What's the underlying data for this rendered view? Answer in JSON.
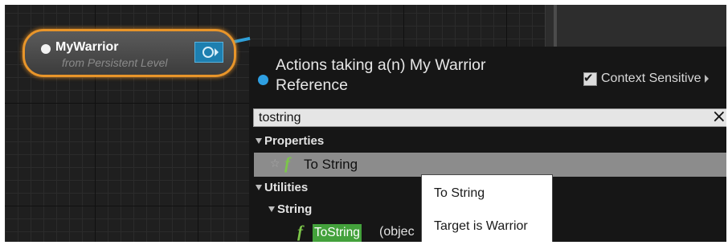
{
  "node": {
    "title": "MyWarrior",
    "subtitle": "from Persistent Level"
  },
  "menu": {
    "title": "Actions taking a(n) My Warrior Reference",
    "context_label": "Context Sensitive",
    "context_checked": true,
    "search": {
      "value": "tostring",
      "clear_icon": "×"
    },
    "categories": {
      "properties": "Properties",
      "utilities": "Utilities",
      "string": "String"
    },
    "items": {
      "to_string": "To String",
      "tostring_highlight": "ToString",
      "tostring_rest": "(objec"
    }
  },
  "tooltip": {
    "line1": "To String",
    "line2": "Target is Warrior"
  },
  "colors": {
    "node_border": "#e8952a",
    "pin": "#1d7fb0",
    "highlight": "#43a13b",
    "function_icon": "#7cc64a"
  },
  "icons": [
    "pin-icon",
    "checkbox-icon",
    "close-icon",
    "star-icon",
    "function-icon",
    "expand-arrow-icon"
  ]
}
